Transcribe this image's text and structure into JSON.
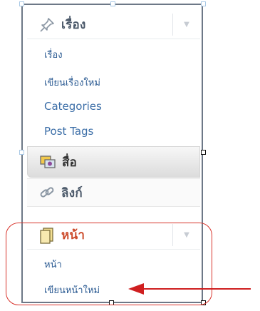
{
  "menu": {
    "posts": {
      "label": "เรื่อง",
      "icon": "pushpin-icon",
      "items": [
        "เรื่อง",
        "เขียนเรื่องใหม่",
        "Categories",
        "Post Tags"
      ]
    },
    "media": {
      "label": "สื่อ",
      "icon": "media-icon"
    },
    "links": {
      "label": "ลิงก์",
      "icon": "chain-link-icon"
    },
    "pages": {
      "label": "หน้า",
      "icon": "pages-icon",
      "items": [
        "หน้า",
        "เขียนหน้าใหม่"
      ]
    }
  },
  "colors": {
    "accent": "#cc4b2b",
    "highlight": "#d8342c",
    "arrow": "#cf1f20",
    "link": "#3d6fa8",
    "frame": "#6d7887"
  },
  "annotation": {
    "icon": "arrow-left-icon"
  }
}
